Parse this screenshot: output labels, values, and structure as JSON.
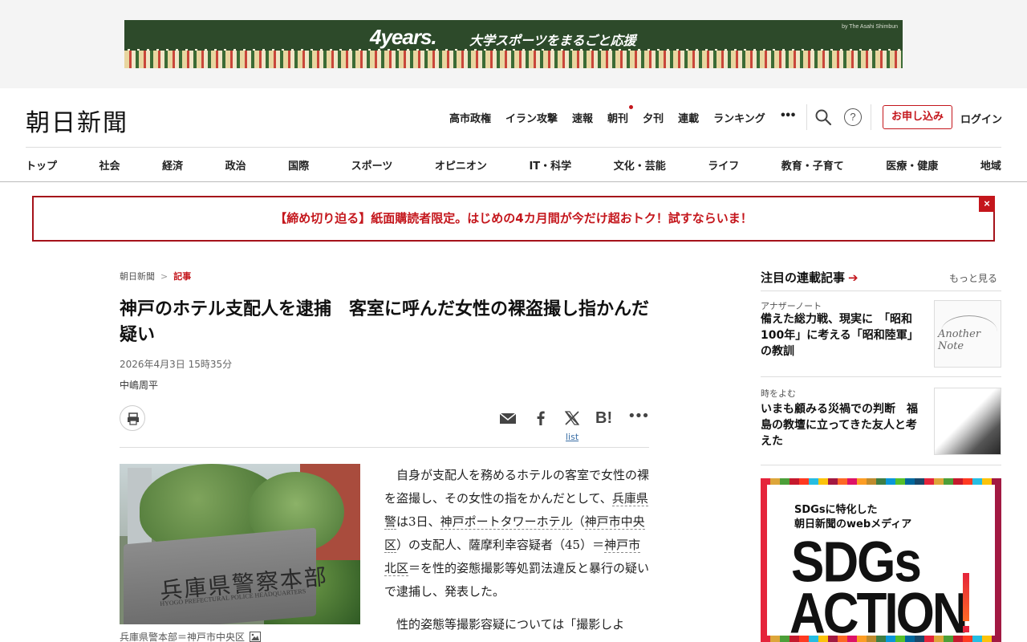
{
  "ad": {
    "logo": "4years.",
    "tagline": "大学スポーツをまるごと応援",
    "by": "by The Asahi Shimbun"
  },
  "header": {
    "logo": "朝日新聞",
    "topnav": [
      "高市政権",
      "イラン攻撃",
      "速報",
      "朝刊",
      "夕刊",
      "連載",
      "ランキング"
    ],
    "more": "•••",
    "subscribe": "お申し込み",
    "login": "ログイン"
  },
  "catnav": [
    "トップ",
    "社会",
    "経済",
    "政治",
    "国際",
    "スポーツ",
    "オピニオン",
    "IT・科学",
    "文化・芸能",
    "ライフ",
    "教育・子育て",
    "医療・健康",
    "地域"
  ],
  "promo": {
    "text": "【締め切り迫る】紙面購読者限定。はじめの4カ月間が今だけ超おトク！試すならいま！",
    "close": "×"
  },
  "article": {
    "breadcrumb": [
      "朝日新聞",
      "記事"
    ],
    "breadcrumb_sep": ">",
    "headline": "神戸のホテル支配人を逮捕　客室に呼んだ女性の裸盗撮し指かんだ疑い",
    "date": "2026年4月3日 15時35分",
    "author": "中嶋周平",
    "share_list": "list",
    "photo": {
      "stone_text": "兵庫県警察本部",
      "stone_sub": "HYOGO PREFECTURAL POLICE HEADQUARTERS",
      "caption": "兵庫県警本部＝神戸市中央区"
    },
    "p1": {
      "t1": "自身が支配人を務めるホテルの客室で女性の裸を盗撮し、その女性の指をかんだとして、",
      "k1": "兵庫県警",
      "t2": "は3日、",
      "k2": "神戸ポートタワーホテル",
      "t3": "（",
      "k3": "神戸市中央区",
      "t4": "）の支配人、薩摩利幸容疑者（45）＝",
      "k4": "神戸市北区",
      "t5": "＝を性的姿態撮影等処罰法違反と暴行の疑いで逮捕し、発表した。"
    },
    "p2": "性的姿態等撮影容疑については「撮影しよ"
  },
  "sidebar": {
    "title": "注目の連載記事",
    "arrow": "➔",
    "more": "もっと見る",
    "items": [
      {
        "kicker": "アナザーノート",
        "title": "備えた総力戦、現実に　「昭和100年」に考える「昭和陸軍」の教訓",
        "thumb_text1": "Another",
        "thumb_text2": "Note"
      },
      {
        "kicker": "時をよむ",
        "title": "いまも顧みる災禍での判断　福島の教壇に立ってきた友人と考えた"
      }
    ],
    "sdgs": {
      "line1": "SDGsに特化した",
      "line2": "朝日新聞のwebメディア",
      "big1": "SDGs",
      "big2": "ACTION"
    }
  }
}
